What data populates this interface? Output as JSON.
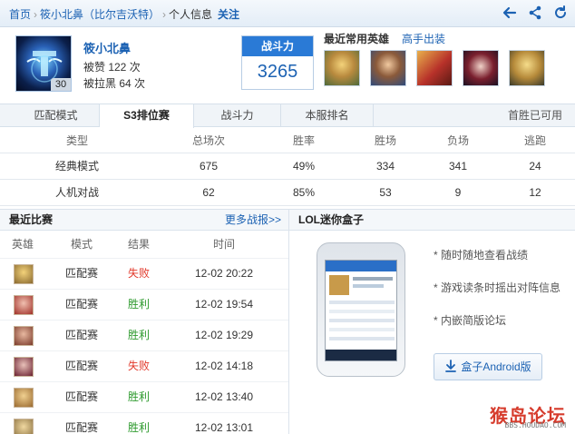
{
  "breadcrumb": {
    "home": "首页",
    "player": "筱小北鼻（比尔吉沃特）",
    "profile": "个人信息",
    "follow": "关注",
    "separator": "›"
  },
  "top_icons": [
    "back-arrow-icon",
    "share-icon",
    "refresh-icon"
  ],
  "profile": {
    "name": "筱小北鼻",
    "level": "30",
    "likes": "被赞 122 次",
    "blacklisted": "被拉黑 64 次"
  },
  "power": {
    "label": "战斗力",
    "value": "3265"
  },
  "heroes": {
    "title": "最近常用英雄",
    "link": "高手出装"
  },
  "tabs": {
    "items": [
      "匹配模式",
      "S3排位赛",
      "战斗力",
      "本服排名"
    ],
    "active": "S3排位赛",
    "right": "首胜已可用"
  },
  "stats": {
    "headers": [
      "类型",
      "总场次",
      "胜率",
      "胜场",
      "负场",
      "逃跑"
    ],
    "rows": [
      [
        "经典模式",
        "675",
        "49%",
        "334",
        "341",
        "24"
      ],
      [
        "人机对战",
        "62",
        "85%",
        "53",
        "9",
        "12"
      ]
    ]
  },
  "recent": {
    "title": "最近比赛",
    "more": "更多战报>>",
    "headers": [
      "英雄",
      "模式",
      "结果",
      "时间"
    ],
    "rows": [
      {
        "mode": "匹配赛",
        "result": "失败",
        "time": "12-02 20:22"
      },
      {
        "mode": "匹配赛",
        "result": "胜利",
        "time": "12-02 19:54"
      },
      {
        "mode": "匹配赛",
        "result": "胜利",
        "time": "12-02 19:29"
      },
      {
        "mode": "匹配赛",
        "result": "失败",
        "time": "12-02 14:18"
      },
      {
        "mode": "匹配赛",
        "result": "胜利",
        "time": "12-02 13:40"
      },
      {
        "mode": "匹配赛",
        "result": "胜利",
        "time": "12-02 13:01"
      }
    ]
  },
  "minibox": {
    "title": "LOL迷你盒子",
    "features": [
      "* 随时随地查看战绩",
      "* 游戏读条时摇出对阵信息",
      "* 内嵌简版论坛"
    ],
    "download": "盒子Android版"
  },
  "watermark": {
    "logo": "猴岛论坛",
    "url": "BBS.HOUDAO.COM"
  },
  "colors": {
    "link": "#1c62b3",
    "accent": "#2a7ad6",
    "lose": "#e23a2c",
    "win": "#2e9a2e"
  }
}
